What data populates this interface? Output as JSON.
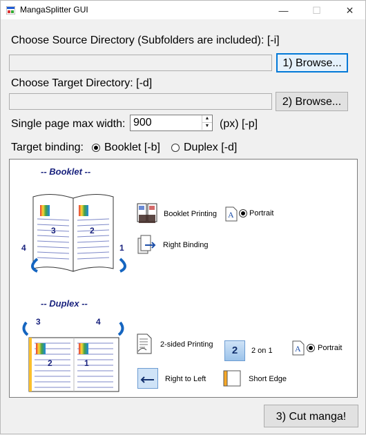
{
  "window": {
    "title": "MangaSplitter GUI",
    "min_glyph": "—",
    "max_glyph": "☐",
    "close_glyph": "✕"
  },
  "source": {
    "label": "Choose Source Directory (Subfolders are included): [-i]",
    "value": "",
    "browse_label": "1) Browse..."
  },
  "target": {
    "label": "Choose Target Directory: [-d]",
    "value": "",
    "browse_label": "2) Browse..."
  },
  "width": {
    "label": "Single page max width:",
    "value": "900",
    "unit": "(px) [-p]"
  },
  "binding": {
    "label": "Target binding:",
    "options": [
      {
        "label": "Booklet [-b]",
        "selected": true
      },
      {
        "label": "Duplex [-d]",
        "selected": false
      }
    ]
  },
  "illustration": {
    "booklet": {
      "title": "-- Booklet --",
      "pages": [
        "3",
        "2"
      ],
      "corners": [
        "4",
        "1"
      ],
      "printing": "Booklet Printing",
      "orientation": "Portrait",
      "binding": "Right Binding"
    },
    "duplex": {
      "title": "-- Duplex --",
      "pages": [
        "2",
        "1"
      ],
      "corners": [
        "3",
        "4"
      ],
      "printing": "2-sided Printing",
      "pages_per_sheet_number": "2",
      "pages_per_sheet": "2 on 1",
      "orientation": "Portrait",
      "direction": "Right to Left",
      "flip": "Short Edge"
    }
  },
  "cut_button": "3) Cut manga!"
}
